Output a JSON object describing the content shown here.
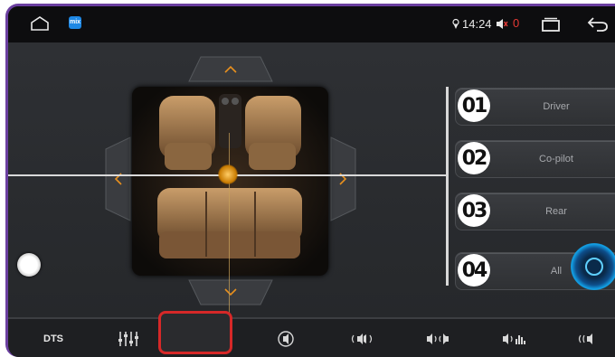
{
  "status_bar": {
    "time": "14:24",
    "notification_count": "0",
    "app_badge": "mix"
  },
  "zones": [
    {
      "number": "01",
      "label": "Driver"
    },
    {
      "number": "02",
      "label": "Co-pilot"
    },
    {
      "number": "03",
      "label": "Rear"
    },
    {
      "number": "04",
      "label": "All"
    }
  ],
  "tabs": [
    {
      "label": "DTS",
      "icon": "dts-text"
    },
    {
      "icon": "equalizer-icon"
    },
    {
      "icon": "seat-zone-icon",
      "selected": true
    },
    {
      "icon": "sound-effect-icon"
    },
    {
      "icon": "surround-icon"
    },
    {
      "icon": "balance-icon"
    },
    {
      "icon": "bass-icon"
    },
    {
      "icon": "fade-icon"
    }
  ],
  "colors": {
    "accent": "#e8901e",
    "selection": "#d62828",
    "frame": "#6b3fa0",
    "alert": "#e53935"
  }
}
